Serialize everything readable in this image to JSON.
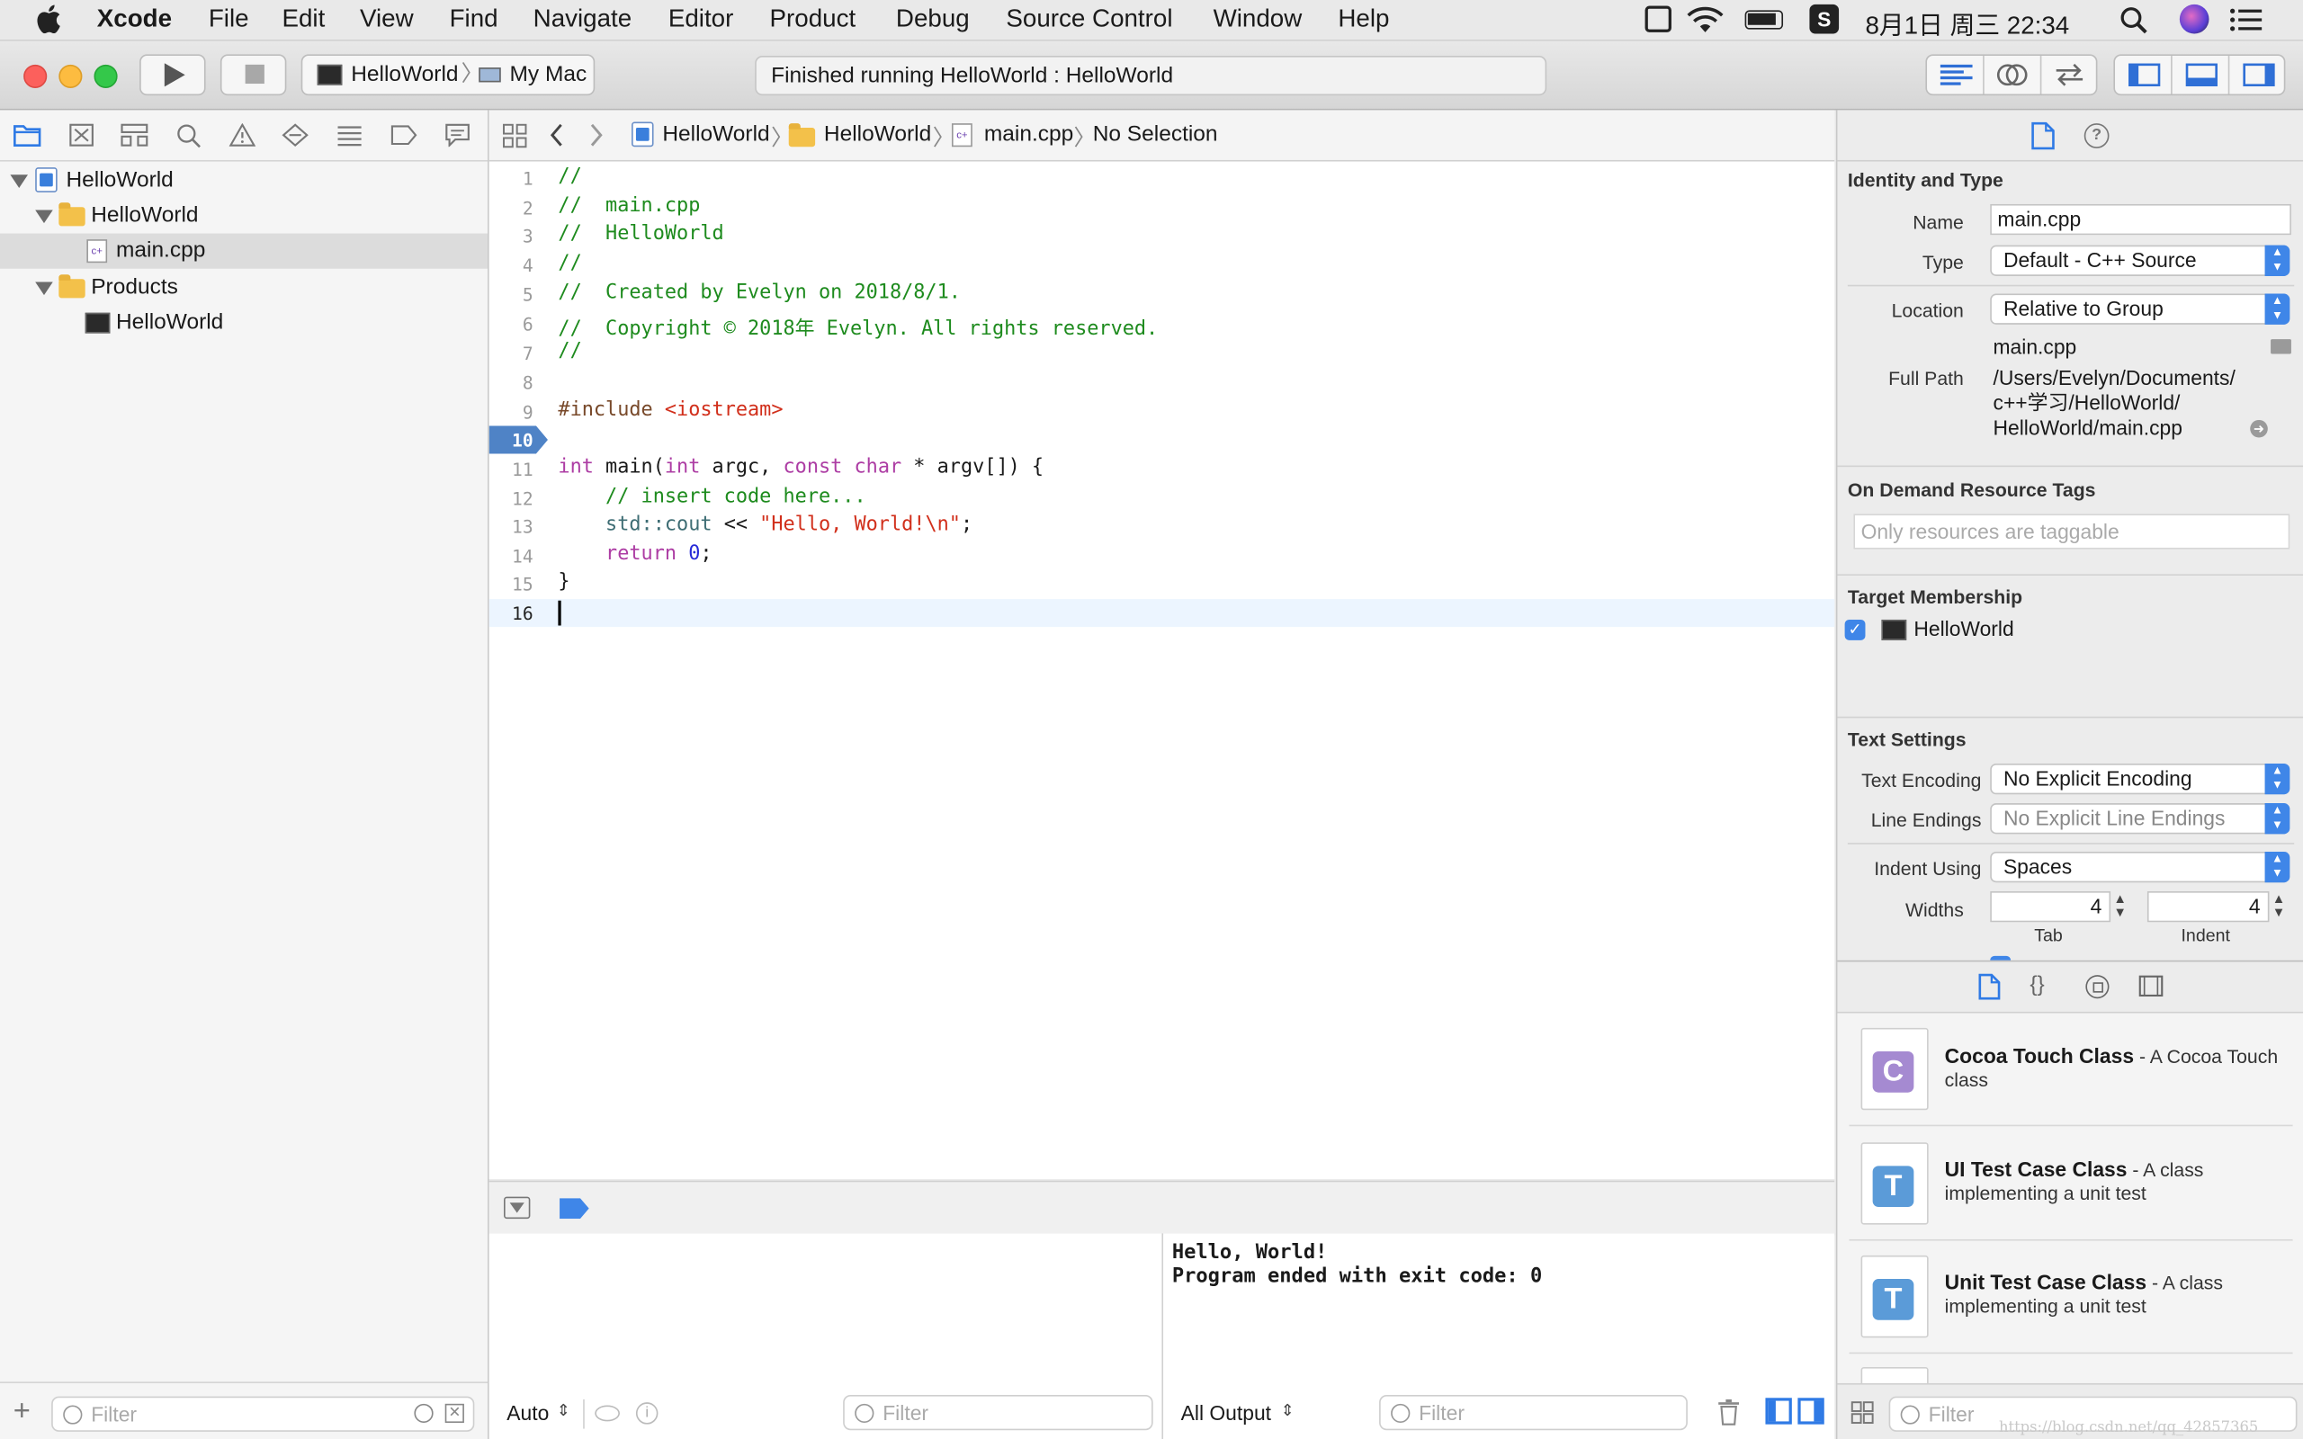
{
  "menubar": {
    "app": "Xcode",
    "items": [
      "File",
      "Edit",
      "View",
      "Find",
      "Navigate",
      "Editor",
      "Product",
      "Debug",
      "Source Control",
      "Window",
      "Help"
    ],
    "clock": "8月1日 周三 22:34"
  },
  "toolbar": {
    "scheme": "HelloWorld",
    "destination": "My Mac",
    "status": "Finished running HelloWorld : HelloWorld"
  },
  "navigator": {
    "tree": [
      {
        "label": "HelloWorld"
      },
      {
        "label": "HelloWorld"
      },
      {
        "label": "main.cpp"
      },
      {
        "label": "Products"
      },
      {
        "label": "HelloWorld"
      }
    ],
    "filter_placeholder": "Filter"
  },
  "jumpbar": {
    "crumbs": [
      "HelloWorld",
      "HelloWorld",
      "main.cpp",
      "No Selection"
    ]
  },
  "editor": {
    "current_line": "10",
    "line_numbers": [
      "1",
      "2",
      "3",
      "4",
      "5",
      "6",
      "7",
      "8",
      "9",
      "10",
      "11",
      "12",
      "13",
      "14",
      "15",
      "16"
    ],
    "lines": [
      "//",
      "//  main.cpp",
      "//  HelloWorld",
      "//",
      "//  Created by Evelyn on 2018/8/1.",
      "//  Copyright © 2018年 Evelyn. All rights reserved.",
      "//",
      "",
      "#include <iostream>",
      "",
      "int main(int argc, const char * argv[]) {",
      "    // insert code here...",
      "    std::cout << \"Hello, World!\\n\";",
      "    return 0;",
      "}",
      ""
    ]
  },
  "debug": {
    "variables_scope": "Auto",
    "filter_placeholder": "Filter",
    "output_scope": "All Output",
    "console_lines": [
      "Hello, World!",
      "Program ended with exit code: 0"
    ]
  },
  "inspector": {
    "identity_title": "Identity and Type",
    "name_label": "Name",
    "name_value": "main.cpp",
    "type_label": "Type",
    "type_value": "Default - C++ Source",
    "location_label": "Location",
    "location_value": "Relative to Group",
    "location_file": "main.cpp",
    "fullpath_label": "Full Path",
    "fullpath_lines": [
      "/Users/Evelyn/Documents/",
      "c++学习/HelloWorld/",
      "HelloWorld/main.cpp"
    ],
    "odr_title": "On Demand Resource Tags",
    "odr_placeholder": "Only resources are taggable",
    "target_title": "Target Membership",
    "target_name": "HelloWorld",
    "text_title": "Text Settings",
    "encoding_label": "Text Encoding",
    "encoding_value": "No Explicit Encoding",
    "endings_label": "Line Endings",
    "endings_value": "No Explicit Line Endings",
    "indent_label": "Indent Using",
    "indent_value": "Spaces",
    "widths_label": "Widths",
    "tab_value": "4",
    "indent_width_value": "4",
    "tab_caption": "Tab",
    "indent_caption": "Indent"
  },
  "library": {
    "items": [
      {
        "title": "Cocoa Touch Class",
        "desc": " - A Cocoa Touch class",
        "letter": "C",
        "color": "#a58ad1"
      },
      {
        "title": "UI Test Case Class",
        "desc": " - A class implementing a unit test",
        "letter": "T",
        "color": "#5b9bd8"
      },
      {
        "title": "Unit Test Case Class",
        "desc": " - A class implementing a unit test",
        "letter": "T",
        "color": "#5b9bd8"
      }
    ],
    "filter_placeholder": "Filter"
  },
  "watermark": "https://blog.csdn.net/qq_42857365"
}
